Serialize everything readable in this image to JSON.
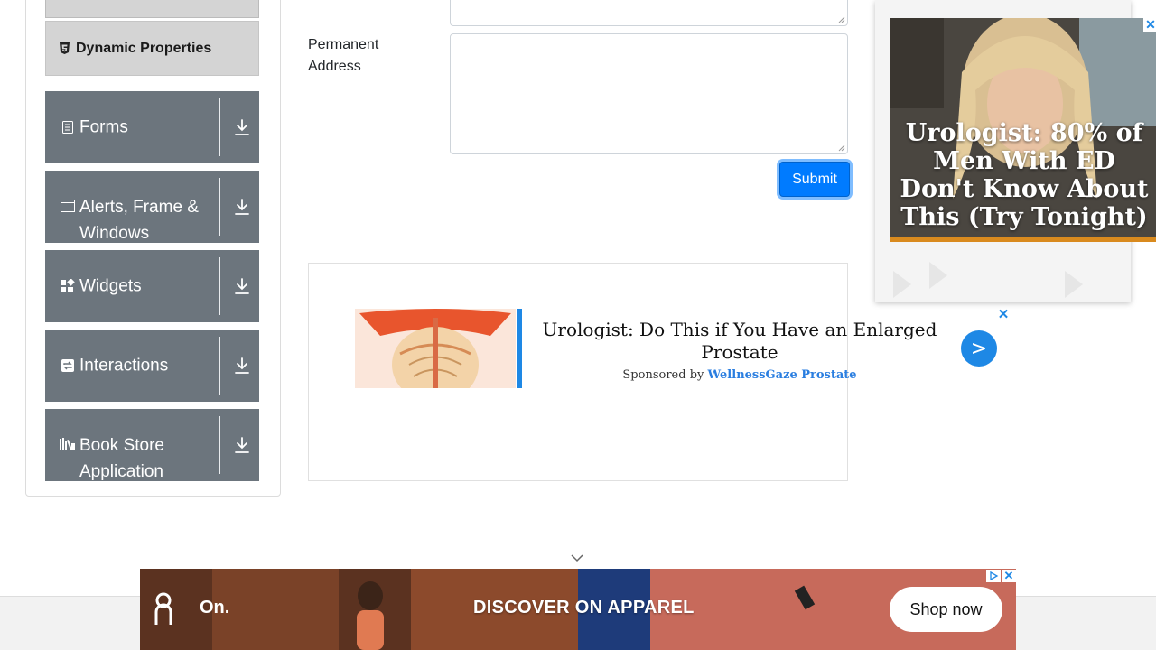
{
  "sidebar": {
    "active_item": {
      "label": "Dynamic Properties",
      "icon": "html5-icon"
    },
    "groups": [
      {
        "label": "Forms",
        "icon": "form-icon"
      },
      {
        "label": "Alerts, Frame & Windows",
        "icon": "window-icon"
      },
      {
        "label": "Widgets",
        "icon": "widgets-icon"
      },
      {
        "label": "Interactions",
        "icon": "interactions-icon"
      },
      {
        "label": "Book Store Application",
        "icon": "books-icon"
      }
    ]
  },
  "form": {
    "permanent_address_label": "Permanent Address",
    "permanent_address_value": "",
    "submit_label": "Submit"
  },
  "ad_middle": {
    "headline": "Urologist: Do This if You Have an Enlarged Prostate",
    "sponsored_prefix": "Sponsored by",
    "sponsor": "WellnessGaze Prostate",
    "go_label": ">",
    "close_label": "✕"
  },
  "ad_right": {
    "text": "Urologist: 80% of Men With ED Don't Know About This (Try Tonight)",
    "close_label": "✕"
  },
  "ad_bottom": {
    "brand": "On.",
    "tagline": "DISCOVER ON APPAREL",
    "cta": "Shop now",
    "close_label": "✕"
  },
  "colors": {
    "group_bg": "#6c757d",
    "active_bg": "#d4d4d4",
    "primary": "#007bff",
    "ad_accent": "#1e88e5"
  }
}
